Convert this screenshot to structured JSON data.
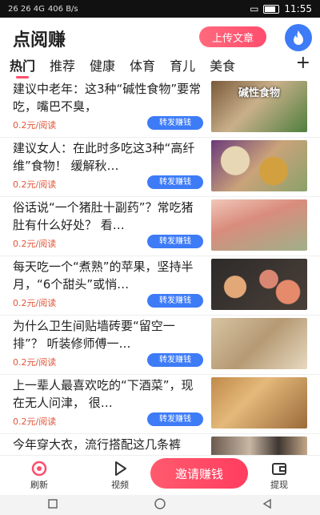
{
  "status_bar": {
    "left_text": "26 26 4G",
    "speed": "406 B/s",
    "time": "11:55"
  },
  "header": {
    "title": "点阅赚",
    "upload_label": "上传文章"
  },
  "tabs": [
    "热门",
    "推荐",
    "健康",
    "体育",
    "育儿",
    "美食"
  ],
  "tabs_add": "+",
  "articles": [
    {
      "title": "建议中老年：这3种“碱性食物”要常吃，嘴巴不臭，",
      "price": "0.2元/阅读",
      "share": "转发赚钱",
      "thumb_caption": "碱性食物"
    },
    {
      "title": "建议女人：在此时多吃这3种“高纤维”食物！ 缓解秋…",
      "price": "0.2元/阅读",
      "share": "转发赚钱",
      "thumb_caption": ""
    },
    {
      "title": "俗话说“一个猪肚十副药”？常吃猪肚有什么好处？ 看…",
      "price": "0.2元/阅读",
      "share": "转发赚钱",
      "thumb_caption": ""
    },
    {
      "title": "每天吃一个“煮熟”的苹果，坚持半月，“6个甜头”或悄…",
      "price": "0.2元/阅读",
      "share": "转发赚钱",
      "thumb_caption": ""
    },
    {
      "title": "为什么卫生间贴墙砖要“留空一排”？ 听装修师傅一…",
      "price": "0.2元/阅读",
      "share": "转发赚钱",
      "thumb_caption": ""
    },
    {
      "title": "上一辈人最喜欢吃的“下酒菜”，现在无人问津， 很…",
      "price": "0.2元/阅读",
      "share": "转发赚钱",
      "thumb_caption": ""
    },
    {
      "title": "今年穿大衣，流行搭配这几条裤子，时髦洋气又显高",
      "price": "",
      "share": "",
      "thumb_caption": ""
    }
  ],
  "bottom_nav": {
    "refresh": "刷新",
    "video": "视频",
    "invite": "邀请赚钱",
    "withdraw": "提现"
  },
  "colors": {
    "accent_red": "#ff4d6d",
    "accent_blue": "#3d7bf7",
    "price": "#e2563a"
  }
}
